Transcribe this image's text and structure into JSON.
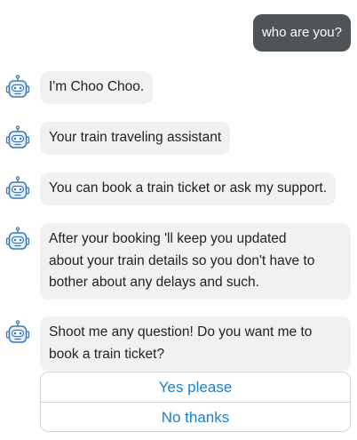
{
  "user_message": "who are you?",
  "bot_messages": [
    {
      "text": "I'm Choo Choo."
    },
    {
      "text": "Your train traveling assistant"
    },
    {
      "text": "You can book a train ticket or ask my support."
    },
    {
      "lines": [
        "After your booking 'll keep you updated",
        "about your train details so you don't have to",
        "bother about any delays and such."
      ]
    },
    {
      "lines": [
        "Shoot me any question! Do you want me to",
        "book a train ticket?"
      ]
    }
  ],
  "quick_replies": [
    "Yes please",
    "No thanks"
  ],
  "colors": {
    "user_bubble": "#4f5459",
    "bot_bubble": "#f1f1f2",
    "reply_text": "#1a7fd0",
    "avatar_stroke": "#3c78b4",
    "avatar_fill": "#e6f0fa"
  },
  "icons": {
    "bot_avatar": "robot-icon"
  }
}
